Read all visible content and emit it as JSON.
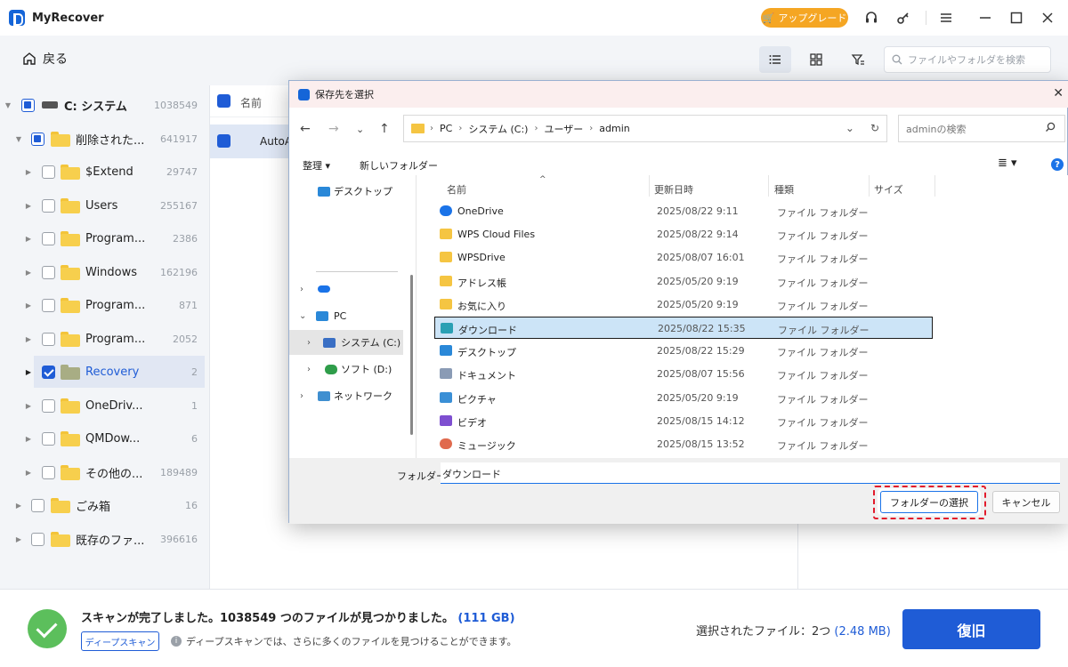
{
  "app": {
    "title": "MyRecover",
    "upgrade_label": "アップグレード",
    "icons": [
      "headset-icon",
      "key-icon",
      "menu-icon",
      "minimize-icon",
      "maximize-icon",
      "close-icon"
    ]
  },
  "toolbar": {
    "back_label": "戻る",
    "search_placeholder": "ファイルやフォルダを検索"
  },
  "tree": {
    "items": [
      {
        "label": "C: システム",
        "count": "1038549",
        "state": "partial",
        "icon": "drive-icon"
      },
      {
        "label": "削除された...",
        "count": "641917",
        "state": "partial",
        "icon": "trash-folder-icon"
      },
      {
        "label": "$Extend",
        "count": "29747",
        "state": "none",
        "icon": "folder-icon"
      },
      {
        "label": "Users",
        "count": "255167",
        "state": "none",
        "icon": "folder-icon"
      },
      {
        "label": "Program...",
        "count": "2386",
        "state": "none",
        "icon": "folder-icon"
      },
      {
        "label": "Windows",
        "count": "162196",
        "state": "none",
        "icon": "folder-icon"
      },
      {
        "label": "Program...",
        "count": "871",
        "state": "none",
        "icon": "folder-icon"
      },
      {
        "label": "Program...",
        "count": "2052",
        "state": "none",
        "icon": "folder-icon"
      },
      {
        "label": "Recovery",
        "count": "2",
        "state": "checked",
        "icon": "folder-icon"
      },
      {
        "label": "OneDriv...",
        "count": "1",
        "state": "none",
        "icon": "folder-icon"
      },
      {
        "label": "QMDow...",
        "count": "6",
        "state": "none",
        "icon": "folder-icon"
      },
      {
        "label": "その他の...",
        "count": "189489",
        "state": "none",
        "icon": "folder-icon"
      },
      {
        "label": "ごみ箱",
        "count": "16",
        "state": "none",
        "icon": "recycle-folder-icon"
      },
      {
        "label": "既存のファ...",
        "count": "396616",
        "state": "none",
        "icon": "folder-icon"
      }
    ]
  },
  "midlist": {
    "header_name": "名前",
    "row_name": "AutoA"
  },
  "bottom": {
    "scan_message": "スキャンが完了しました。1038549 つのファイルが見つかりました。",
    "scan_size": "(111 GB)",
    "deep_scan_label": "ディープスキャン",
    "deep_scan_info": "ディープスキャンでは、さらに多くのファイルを見つけることができます。",
    "selected_label": "選択されたファイル：2つ",
    "selected_size": "(2.48 MB)",
    "recover_label": "復旧"
  },
  "dialog": {
    "title": "保存先を選択",
    "address": [
      "PC",
      "システム (C:)",
      "ユーザー",
      "admin"
    ],
    "search_placeholder": "adminの検索",
    "organize_label": "整理 ▾",
    "new_folder_label": "新しいフォルダー",
    "nav": {
      "desktop": "デスクトップ",
      "onedrive": "",
      "pc": "PC",
      "system_c": "システム (C:)",
      "soft_d": "ソフト (D:)",
      "network": "ネットワーク"
    },
    "columns": {
      "name": "名前",
      "date": "更新日時",
      "type": "種類",
      "size": "サイズ"
    },
    "files": [
      {
        "name": "OneDrive",
        "date": "2025/08/22 9:11",
        "type": "ファイル フォルダー",
        "icon": "onedrive-icon"
      },
      {
        "name": "WPS Cloud Files",
        "date": "2025/08/22 9:14",
        "type": "ファイル フォルダー",
        "icon": "folder-icon"
      },
      {
        "name": "WPSDrive",
        "date": "2025/08/07 16:01",
        "type": "ファイル フォルダー",
        "icon": "folder-icon"
      },
      {
        "name": "アドレス帳",
        "date": "2025/05/20 9:19",
        "type": "ファイル フォルダー",
        "icon": "folder-icon"
      },
      {
        "name": "お気に入り",
        "date": "2025/05/20 9:19",
        "type": "ファイル フォルダー",
        "icon": "folder-icon"
      },
      {
        "name": "ダウンロード",
        "date": "2025/08/22 15:35",
        "type": "ファイル フォルダー",
        "icon": "download-icon"
      },
      {
        "name": "デスクトップ",
        "date": "2025/08/22 15:29",
        "type": "ファイル フォルダー",
        "icon": "desktop-icon"
      },
      {
        "name": "ドキュメント",
        "date": "2025/08/07 15:56",
        "type": "ファイル フォルダー",
        "icon": "document-icon"
      },
      {
        "name": "ピクチャ",
        "date": "2025/05/20 9:19",
        "type": "ファイル フォルダー",
        "icon": "picture-icon"
      },
      {
        "name": "ビデオ",
        "date": "2025/08/15 14:12",
        "type": "ファイル フォルダー",
        "icon": "video-icon"
      },
      {
        "name": "ミュージック",
        "date": "2025/08/15 13:52",
        "type": "ファイル フォルダー",
        "icon": "music-icon"
      }
    ],
    "folder_label": "フォルダー:",
    "folder_value": "ダウンロード",
    "select_label": "フォルダーの選択",
    "cancel_label": "キャンセル"
  },
  "colors": {
    "accent": "#1f5cd6",
    "upgrade": "#f5a623",
    "highlight_outline": "#e21b2c",
    "success": "#5cbf5c"
  }
}
